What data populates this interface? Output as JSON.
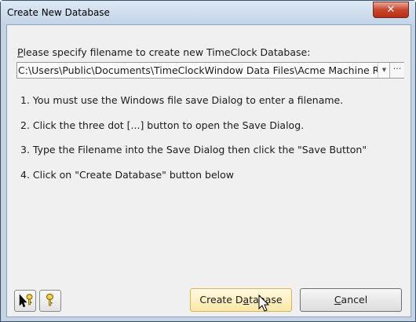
{
  "window": {
    "title": "Create New Database",
    "close_label": "✕"
  },
  "form": {
    "prompt_prefix": "P",
    "prompt_rest": "lease specify filename to create new TimeClock Database:",
    "filename_value": "C:\\Users\\Public\\Documents\\TimeClockWindow Data Files\\Acme Machine Repa",
    "browse_label": "···"
  },
  "steps": [
    "1. You must use the Windows file save Dialog to enter a filename.",
    "2. Click the three dot [...] button to open the Save Dialog.",
    "3. Type the Filename into the Save Dialog then click the \"Save Button\"",
    "4. Click on \"Create Database\" button below"
  ],
  "buttons": {
    "create_prefix": "Create D",
    "create_underlined": "a",
    "create_suffix": "tabase",
    "cancel_underlined": "C",
    "cancel_suffix": "ancel"
  },
  "icons": {
    "whats_this": "pointer-help-icon",
    "help": "help-key-icon"
  }
}
